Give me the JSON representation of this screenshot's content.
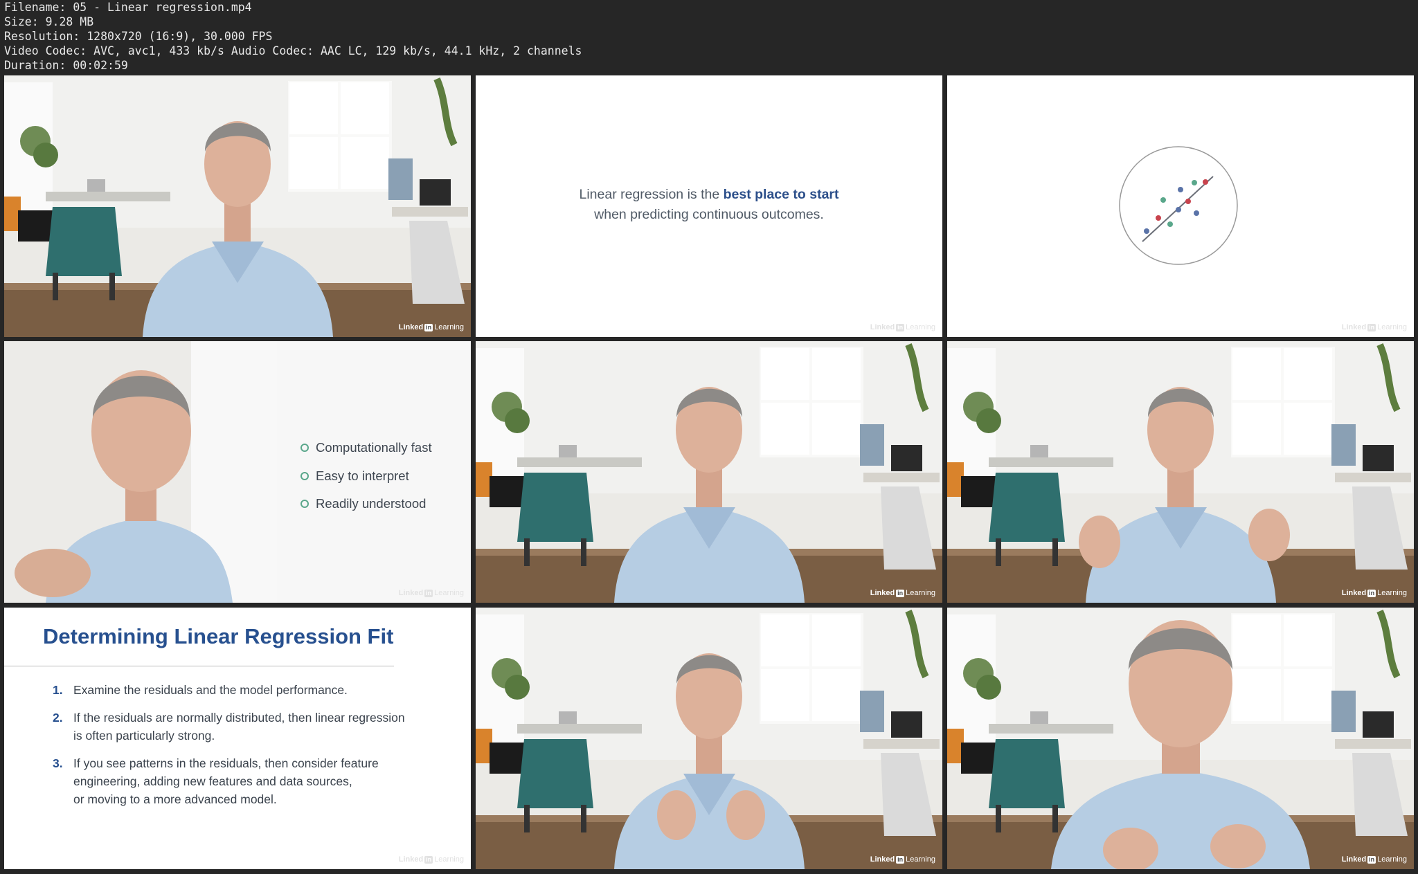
{
  "header": {
    "filename": "Filename: 05 - Linear regression.mp4",
    "size": "Size: 9.28 MB",
    "resolution": "Resolution: 1280x720 (16:9), 30.000 FPS",
    "codec": "Video Codec: AVC, avc1, 433 kb/s Audio Codec: AAC LC, 129 kb/s, 44.1 kHz, 2 channels",
    "duration": "Duration: 00:02:59"
  },
  "watermark": {
    "brand": "Linked",
    "in": "in",
    "learning": "Learning"
  },
  "slide_quote": {
    "pre": "Linear regression is the ",
    "bold": "best place to start",
    "line2": "when predicting continuous outcomes."
  },
  "slide_bullets": [
    "Computationally fast",
    "Easy to interpret",
    "Readily understood"
  ],
  "slide_fit": {
    "title": "Determining Linear Regression Fit",
    "items": [
      {
        "num": "1.",
        "text": "Examine the residuals and the model performance."
      },
      {
        "num": "2.",
        "text": "If the residuals are normally distributed, then linear regression\nis often particularly strong."
      },
      {
        "num": "3.",
        "text": "If you see patterns in the residuals, then consider feature\nengineering, adding new features and data sources,\nor moving to a more advanced model."
      }
    ]
  },
  "colors": {
    "accent_blue": "#27508f",
    "green": "#5aa78b",
    "red": "#c8434d",
    "point_blue": "#5a73a8"
  }
}
